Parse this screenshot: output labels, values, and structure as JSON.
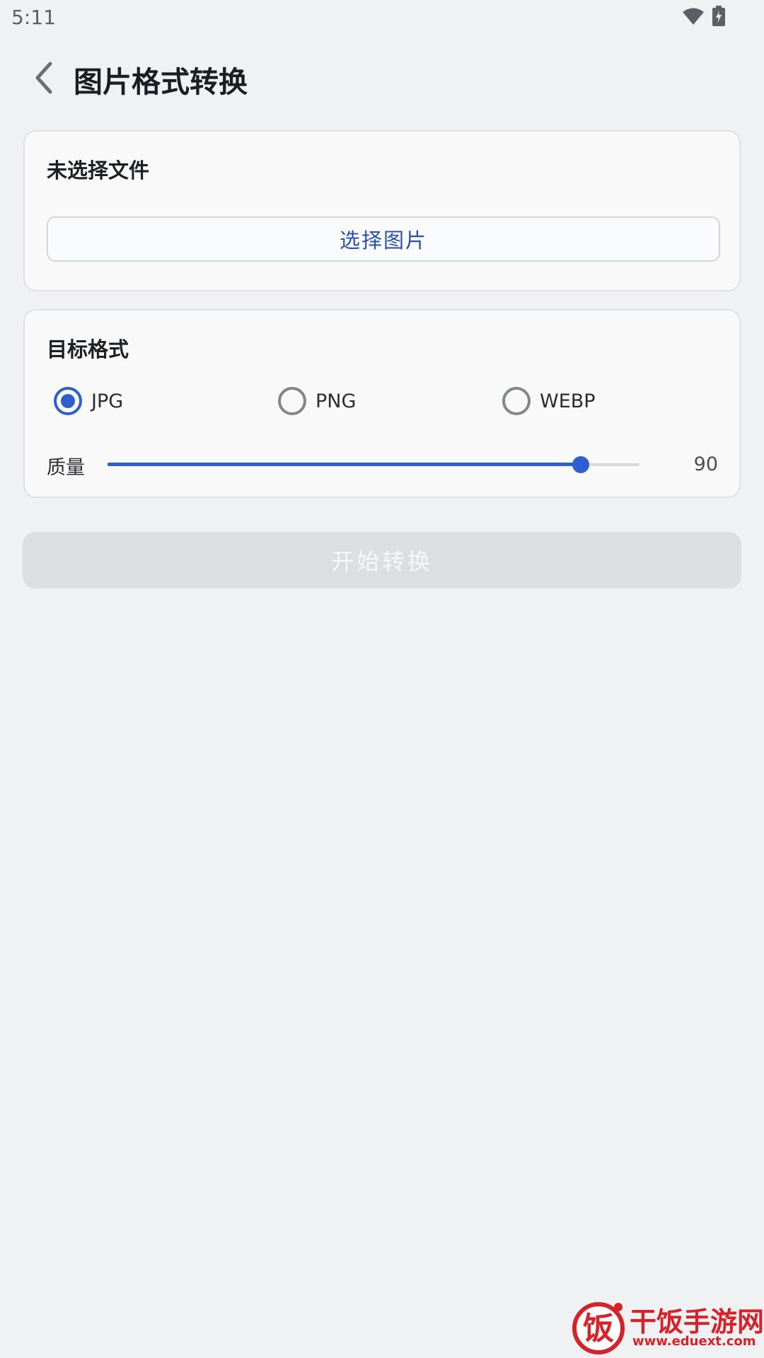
{
  "status_bar": {
    "time": "5:11"
  },
  "header": {
    "title": "图片格式转换",
    "back_icon": "chevron-left-icon"
  },
  "file_card": {
    "status_text": "未选择文件",
    "select_button_label": "选择图片"
  },
  "format_card": {
    "heading": "目标格式",
    "options": [
      {
        "label": "JPG",
        "selected": true
      },
      {
        "label": "PNG",
        "selected": false
      },
      {
        "label": "WEBP",
        "selected": false
      }
    ],
    "quality_label": "质量",
    "quality_value": "90",
    "quality_slider_fraction": 0.89
  },
  "start_button_label": "开始转换",
  "watermark": {
    "logo_char": "饭",
    "name": "干饭手游网",
    "url": "www.eduext.com"
  },
  "colors": {
    "accent": "#2f5fcf",
    "disabled": "#dcdfe1",
    "background": "#f0f1f3",
    "watermark": "#d6232a"
  }
}
